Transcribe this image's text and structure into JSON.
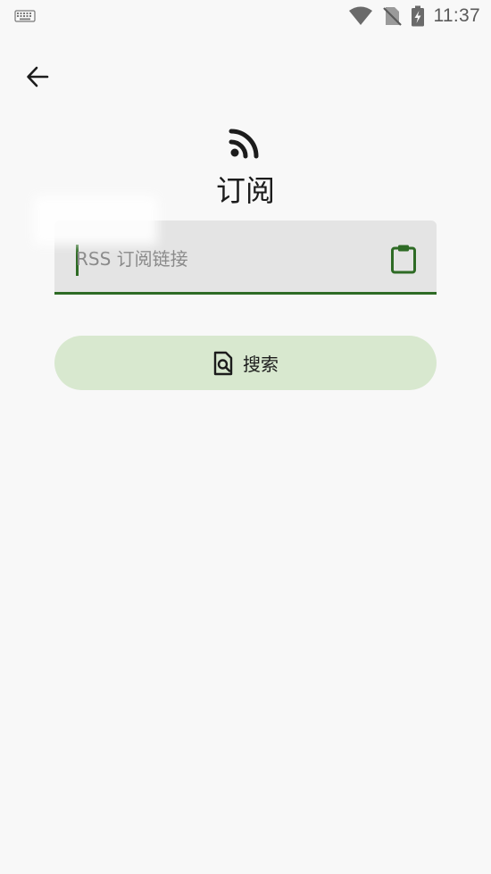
{
  "status_bar": {
    "time": "11:37",
    "icons": [
      "keyboard-icon",
      "wifi-icon",
      "no-sim-icon",
      "battery-charging-icon"
    ]
  },
  "header": {
    "back_icon": "arrow-back-icon"
  },
  "main": {
    "icon": "rss-icon",
    "title": "订阅",
    "input": {
      "placeholder": "RSS 订阅链接",
      "value": "",
      "trailing_icon": "clipboard-icon"
    },
    "search_button": {
      "icon": "search-document-icon",
      "label": "搜索"
    }
  },
  "colors": {
    "accent": "#2e6b25",
    "button_bg": "#d8e8cf",
    "input_bg": "#e4e4e4",
    "background": "#f8f8f8"
  }
}
